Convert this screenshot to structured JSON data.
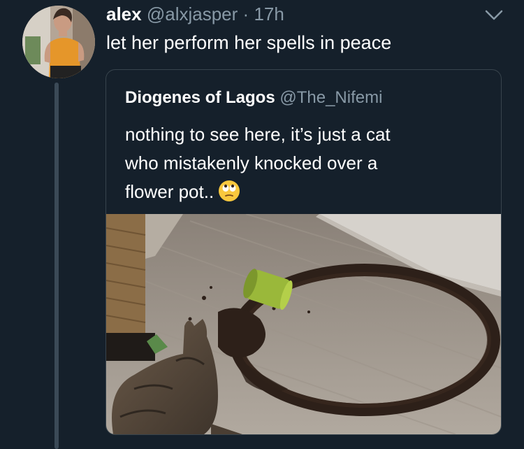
{
  "tweet": {
    "author_name": "alex",
    "author_handle": "@alxjasper",
    "separator": "·",
    "time": "17h",
    "text": "let her perform her spells in peace"
  },
  "quoted_tweet": {
    "author_name": "Diogenes of Lagos",
    "author_handle": "@The_Nifemi",
    "text_lines": [
      "nothing to see here, it’s just a cat",
      "who mistakenly knocked over a",
      "flower pot.."
    ],
    "emoji": "face-with-rolling-eyes"
  },
  "icons": {
    "menu": "chevron-down-icon"
  },
  "colors": {
    "background": "#15202b",
    "secondary_text": "#8899a6",
    "border": "#38444d",
    "thread_line": "#3b4a57"
  }
}
